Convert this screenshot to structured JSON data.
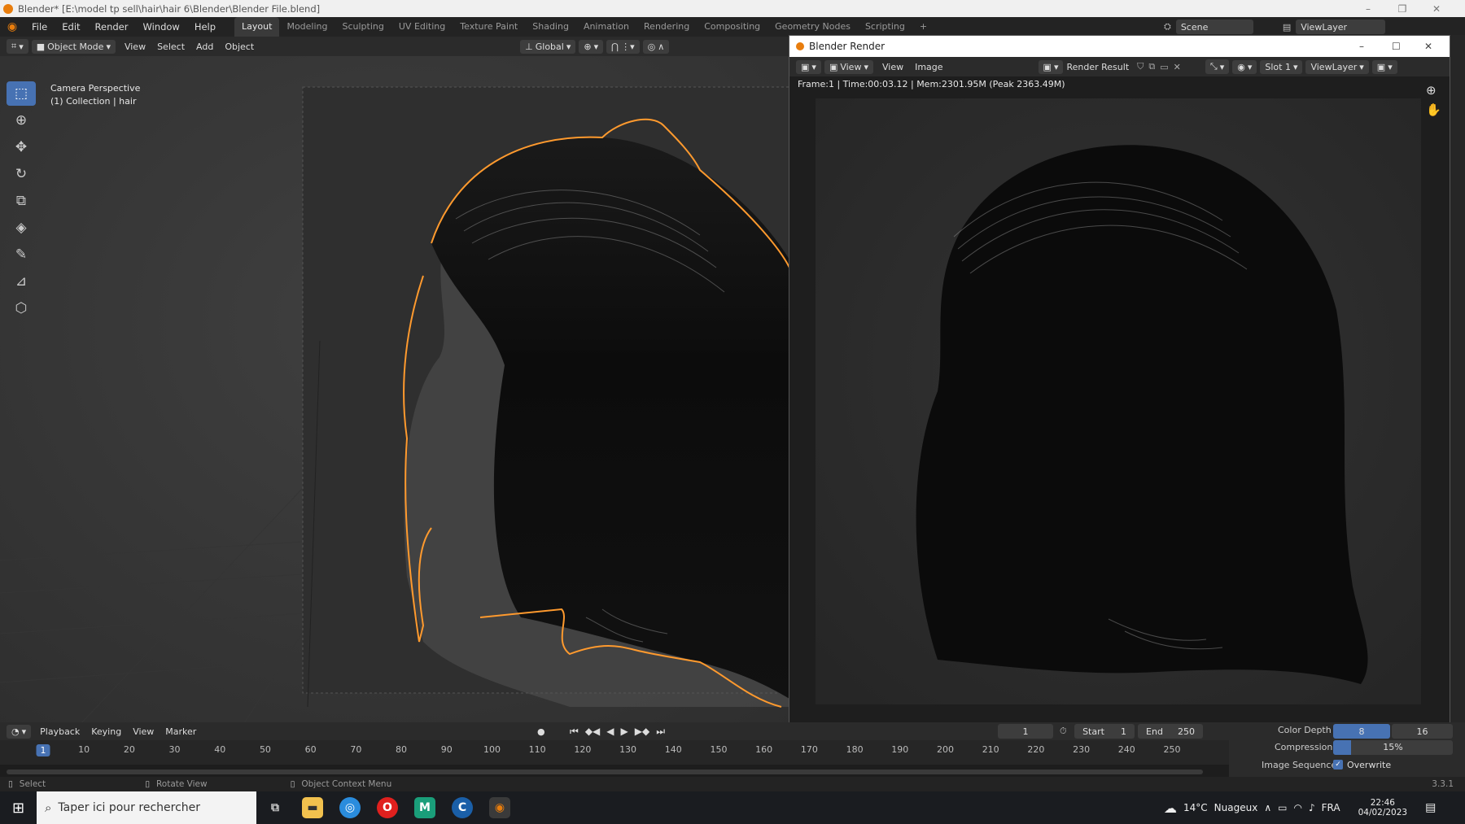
{
  "window_title": "Blender* [E:\\model tp sell\\hair\\hair 6\\Blender\\Blender File.blend]",
  "menu": [
    "File",
    "Edit",
    "Render",
    "Window",
    "Help"
  ],
  "workspace_tabs": [
    "Layout",
    "Modeling",
    "Sculpting",
    "UV Editing",
    "Texture Paint",
    "Shading",
    "Animation",
    "Rendering",
    "Compositing",
    "Geometry Nodes",
    "Scripting"
  ],
  "active_tab": "Layout",
  "scene": "Scene",
  "view_layer": "ViewLayer",
  "viewport_header": {
    "mode": "Object Mode",
    "menus": [
      "View",
      "Select",
      "Add",
      "Object"
    ],
    "transform": "Global"
  },
  "viewport_overlay": {
    "line1": "Camera Perspective",
    "line2": "(1) Collection | hair"
  },
  "render_window": {
    "title": "Blender Render",
    "menus": [
      "View",
      "View",
      "Image"
    ],
    "image_name": "Render Result",
    "slot": "Slot 1",
    "view_layer": "ViewLayer",
    "info": "Frame:1 | Time:00:03.12 | Mem:2301.95M (Peak 2363.49M)"
  },
  "timeline": {
    "menus": [
      "Playback",
      "Keying",
      "View",
      "Marker"
    ],
    "current_frame": "1",
    "start_label": "Start",
    "start": "1",
    "end_label": "End",
    "end": "250",
    "ticks": [
      "1",
      "10",
      "20",
      "30",
      "40",
      "50",
      "60",
      "70",
      "80",
      "90",
      "100",
      "110",
      "120",
      "130",
      "140",
      "150",
      "160",
      "170",
      "180",
      "190",
      "200",
      "210",
      "220",
      "230",
      "240",
      "250"
    ]
  },
  "output_props": {
    "color_depth_label": "Color Depth",
    "color_depth_a": "8",
    "color_depth_b": "16",
    "compression_label": "Compression",
    "compression": "15%",
    "compression_fraction": 0.15,
    "image_sequence_label": "Image Sequence",
    "overwrite": "Overwrite"
  },
  "statusbar": {
    "select": "Select",
    "rotate": "Rotate View",
    "context": "Object Context Menu",
    "version": "3.3.1"
  },
  "taskbar": {
    "search_placeholder": "Taper ici pour rechercher",
    "weather": "14°C",
    "weather_desc": "Nuageux",
    "lang": "FRA",
    "time": "22:46",
    "date": "04/02/2023"
  },
  "colors": {
    "selection_outline": "#ff9a2e",
    "accent": "#4772b3"
  }
}
